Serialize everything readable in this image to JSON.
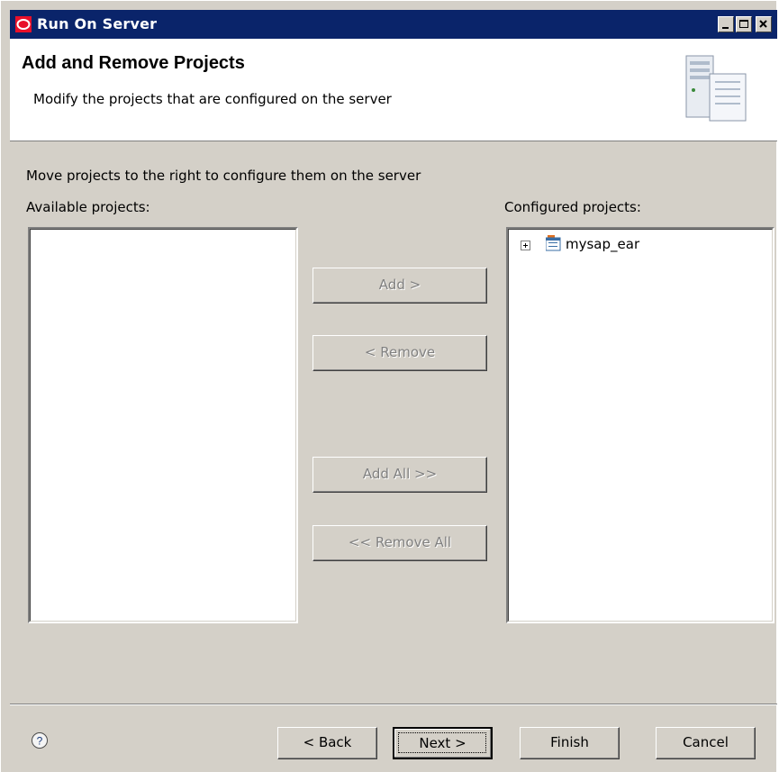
{
  "window": {
    "title": "Run On Server",
    "controls": [
      "minimize",
      "maximize",
      "close"
    ]
  },
  "header": {
    "title": "Add and Remove Projects",
    "subtitle": "Modify the projects that are configured on the server"
  },
  "content": {
    "instruction": "Move projects to the right to configure them on the server",
    "available_label": "Available projects:",
    "configured_label": "Configured projects:",
    "available_items": [],
    "configured_items": [
      {
        "label": "mysap_ear",
        "expandable": true,
        "icon": "ear-project-icon"
      }
    ]
  },
  "transfer_buttons": {
    "add": "Add >",
    "remove": "< Remove",
    "add_all": "Add All >>",
    "remove_all": "<< Remove All"
  },
  "footer": {
    "back": "< Back",
    "next": "Next >",
    "finish": "Finish",
    "cancel": "Cancel"
  },
  "colors": {
    "titlebar": "#0a246a",
    "dialog_bg": "#d4d0c8",
    "disabled_text": "#808080"
  }
}
